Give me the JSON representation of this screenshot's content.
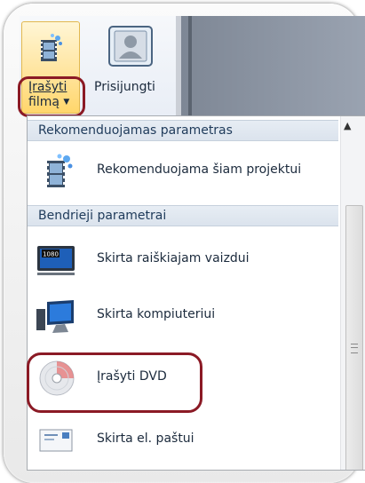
{
  "ribbon": {
    "burn_button": {
      "label_line1": "Įrašyti",
      "label_line2": "filmą",
      "icon": "film-strip-sparkle-icon"
    },
    "signin_button": {
      "label": "Prisijungti",
      "icon": "user-portrait-icon"
    }
  },
  "menu": {
    "sections": [
      {
        "header": "Rekomenduojamas parametras",
        "items": [
          {
            "label": "Rekomenduojama šiam projektui",
            "icon": "film-strip-sparkle-icon"
          }
        ]
      },
      {
        "header": "Bendrieji parametrai",
        "items": [
          {
            "label": "Skirta raiškiajam vaizdui",
            "icon": "hd-1080-display-icon",
            "badge": "1080"
          },
          {
            "label": "Skirta kompiuteriui",
            "icon": "computer-monitor-icon"
          },
          {
            "label": "Įrašyti DVD",
            "icon": "dvd-disc-icon"
          },
          {
            "label": "Skirta el. paštui",
            "icon": "email-envelope-icon"
          }
        ]
      }
    ]
  },
  "colors": {
    "highlight_circle": "#8b1a25",
    "section_header_text": "#1e3a5a"
  }
}
